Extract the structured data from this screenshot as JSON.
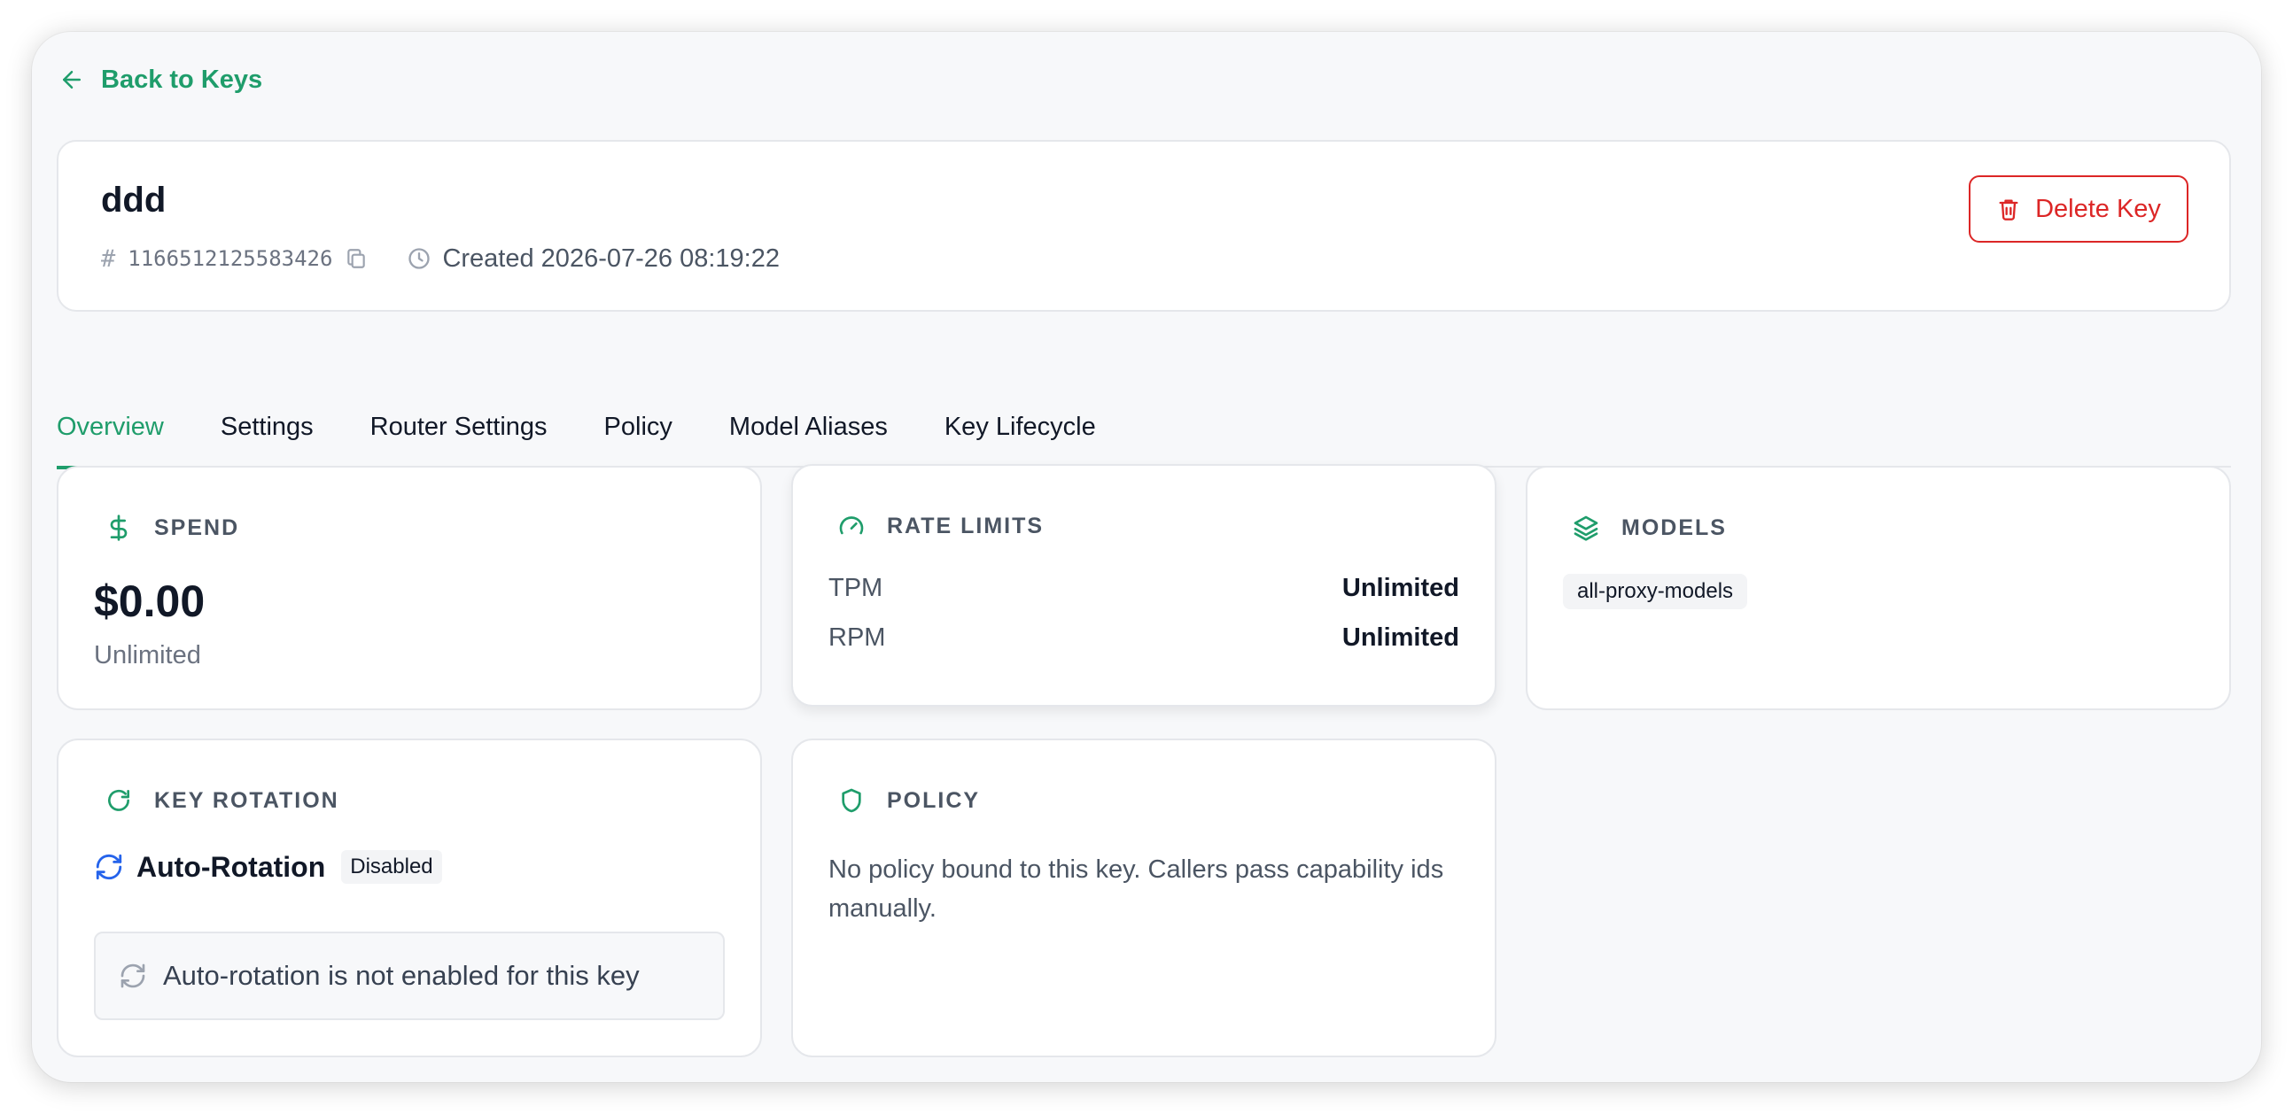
{
  "nav": {
    "back_label": "Back to Keys"
  },
  "key": {
    "name": "ddd",
    "id": "1166512125583426",
    "created": "Created 2026-07-26 08:19:22",
    "delete_label": "Delete Key"
  },
  "tabs": [
    {
      "label": "Overview",
      "active": true
    },
    {
      "label": "Settings"
    },
    {
      "label": "Router Settings"
    },
    {
      "label": "Policy"
    },
    {
      "label": "Model Aliases"
    },
    {
      "label": "Key Lifecycle"
    }
  ],
  "spend": {
    "title": "SPEND",
    "value": "$0.00",
    "limit": "Unlimited"
  },
  "rate_limits": {
    "title": "RATE LIMITS",
    "rows": [
      {
        "label": "TPM",
        "value": "Unlimited"
      },
      {
        "label": "RPM",
        "value": "Unlimited"
      }
    ]
  },
  "models": {
    "title": "MODELS",
    "items": [
      "all-proxy-models"
    ]
  },
  "key_rotation": {
    "title": "KEY ROTATION",
    "heading": "Auto-Rotation",
    "status": "Disabled",
    "note": "Auto-rotation is not enabled for this key"
  },
  "policy": {
    "title": "POLICY",
    "text": "No policy bound to this key. Callers pass capability ids manually."
  },
  "colors": {
    "accent": "#1f9d6b",
    "danger": "#dc2626",
    "rotation_icon": "#2563eb"
  },
  "icons": {
    "back": "arrow-left-icon",
    "id": "hash-icon",
    "copy": "copy-icon",
    "created": "clock-icon",
    "delete": "trash-icon",
    "spend": "dollar-icon",
    "rate_limits": "gauge-icon",
    "models": "layers-icon",
    "key_rotation": "refresh-icon",
    "policy": "shield-icon"
  }
}
